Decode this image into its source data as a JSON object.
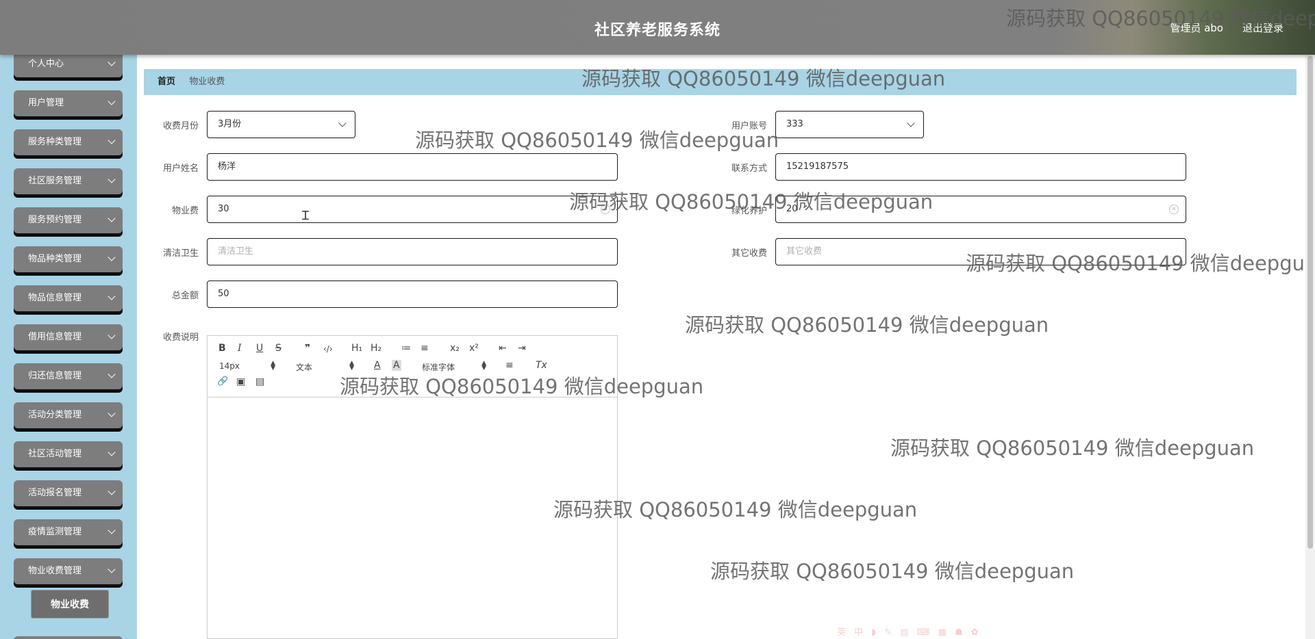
{
  "header": {
    "title": "社区养老服务系统",
    "admin": "管理员 abo",
    "logout": "退出登录"
  },
  "sidebar": {
    "items": [
      "个人中心",
      "用户管理",
      "服务种类管理",
      "社区服务管理",
      "服务预约管理",
      "物品种类管理",
      "物品信息管理",
      "借用信息管理",
      "归还信息管理",
      "活动分类管理",
      "社区活动管理",
      "活动报名管理",
      "疫情监测管理",
      "物业收费管理"
    ],
    "active_sub": "物业收费"
  },
  "breadcrumb": {
    "home": "首页",
    "separator": "/",
    "current": "物业收费"
  },
  "form": {
    "month_label": "收费月份",
    "month_value": "3月份",
    "account_label": "用户账号",
    "account_value": "333",
    "name_label": "用户姓名",
    "name_value": "杨洋",
    "phone_label": "联系方式",
    "phone_value": "15219187575",
    "property_fee_label": "物业费",
    "property_fee_value": "30",
    "green_label": "绿化养护",
    "green_value": "20",
    "clean_label": "清洁卫生",
    "clean_placeholder": "清洁卫生",
    "other_label": "其它收费",
    "other_placeholder": "其它收费",
    "total_label": "总金额",
    "total_value": "50",
    "desc_label": "收费说明"
  },
  "editor": {
    "bold": "B",
    "italic": "I",
    "underline": "U",
    "strike": "S",
    "quote": "❞",
    "code": "‹/›",
    "h1": "H₁",
    "h2": "H₂",
    "ol": "≔",
    "ul": "≡",
    "sub": "x₂",
    "sup": "x²",
    "outdent": "⇤",
    "indent": "⇥",
    "font_size": "14px",
    "text_type": "文本",
    "font_color": "A",
    "bg_color": "A",
    "font_family": "标准字体",
    "align": "≡",
    "clear": "Tx",
    "link": "🔗",
    "image": "▣",
    "video": "▤"
  },
  "watermark": "源码获取 QQ86050149 微信deepguan",
  "faint_icons": "英 中 ◗ ✎ ▤ ⌨ ▦ ☗ ✿"
}
